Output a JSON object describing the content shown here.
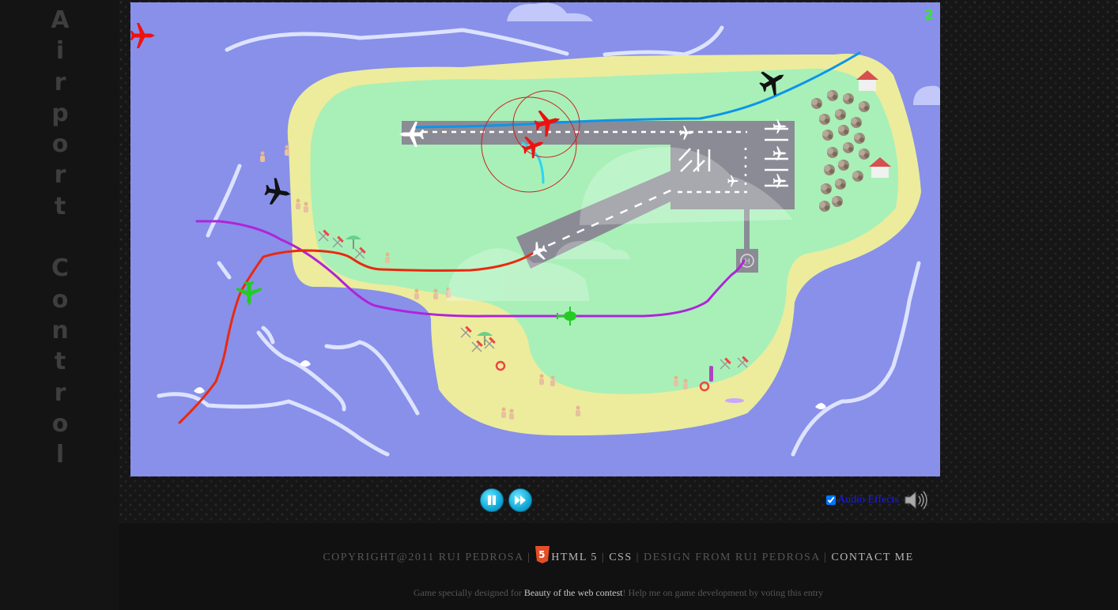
{
  "title_letters": [
    "A",
    "i",
    "r",
    "p",
    "o",
    "r",
    "t",
    " ",
    "C",
    "o",
    "n",
    "t",
    "r",
    "o",
    "l"
  ],
  "game": {
    "score": "2",
    "colors": {
      "sea": "#8890ea",
      "sand": "#ecec9c",
      "grass": "#a8f0b8",
      "runway": "#8b8b95",
      "path_red": "#e82a10",
      "path_purple": "#b024d8",
      "path_blue": "#0d94ea",
      "path_cyan": "#2cd6ee",
      "plane_red": "#ee1111",
      "plane_black": "#111111",
      "plane_green": "#22cc22"
    }
  },
  "controls": {
    "pause_label": "pause",
    "fast_forward_label": "fast-forward",
    "audio_label": "Audio Effects",
    "audio_checked": true
  },
  "footer": {
    "copyright": "COPYRIGHT@2011 RUI PEDROSA",
    "sep": "|",
    "html5": "HTML 5",
    "css": "CSS",
    "design": "DESIGN FROM RUI PEDROSA",
    "contact": "CONTACT ME",
    "note_pre": "Game specially designed for ",
    "note_link": "Beauty of the web contest",
    "note_post": "! Help me on game development by voting this entry"
  }
}
